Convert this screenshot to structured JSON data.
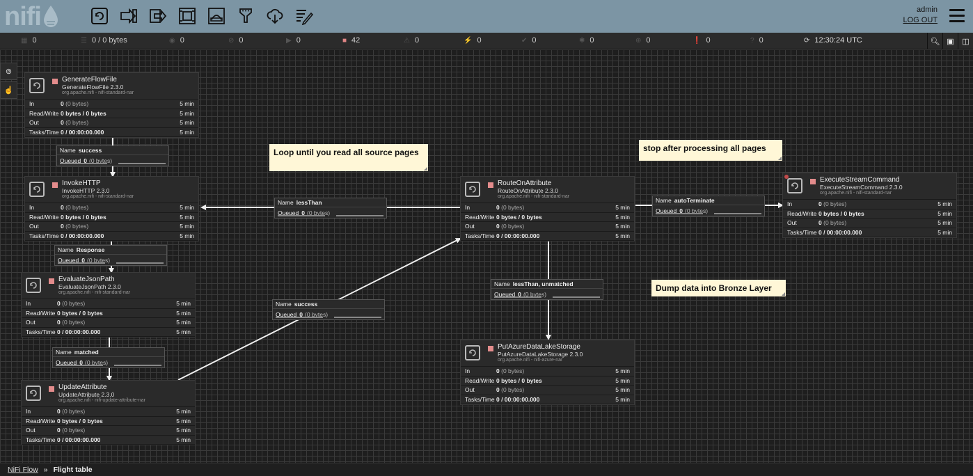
{
  "header": {
    "logo_text": "nifi",
    "user": "admin",
    "logout": "LOG OUT",
    "tools": [
      "processor-icon",
      "input-port-icon",
      "output-port-icon",
      "process-group-icon",
      "remote-process-group-icon",
      "funnel-icon",
      "template-icon",
      "label-icon"
    ]
  },
  "status": {
    "threads": "0",
    "queued": "0 / 0 bytes",
    "transmitting": "0",
    "not_transmitting": "0",
    "running": "0",
    "stopped": "42",
    "invalid": "0",
    "disabled": "0",
    "up_to_date": "0",
    "locally_modified": "0",
    "stale": "0",
    "locally_modified_stale": "0",
    "sync_failure": "0",
    "last_refresh": "12:30:24 UTC"
  },
  "processors": [
    {
      "name": "GenerateFlowFile",
      "type": "GenerateFlowFile 2.3.0",
      "bundle": "org.apache.nifi - nifi-standard-nar",
      "in": "0",
      "in_b": "(0 bytes)",
      "rw": "0 bytes / 0 bytes",
      "out": "0",
      "out_b": "(0 bytes)",
      "tasks": "0 / 00:00:00.000",
      "window": "5 min"
    },
    {
      "name": "InvokeHTTP",
      "type": "InvokeHTTP 2.3.0",
      "bundle": "org.apache.nifi - nifi-standard-nar",
      "in": "0",
      "in_b": "(0 bytes)",
      "rw": "0 bytes / 0 bytes",
      "out": "0",
      "out_b": "(0 bytes)",
      "tasks": "0 / 00:00:00.000",
      "window": "5 min"
    },
    {
      "name": "EvaluateJsonPath",
      "type": "EvaluateJsonPath 2.3.0",
      "bundle": "org.apache.nifi - nifi-standard-nar",
      "in": "0",
      "in_b": "(0 bytes)",
      "rw": "0 bytes / 0 bytes",
      "out": "0",
      "out_b": "(0 bytes)",
      "tasks": "0 / 00:00:00.000",
      "window": "5 min"
    },
    {
      "name": "UpdateAttribute",
      "type": "UpdateAttribute 2.3.0",
      "bundle": "org.apache.nifi - nifi-update-attribute-nar",
      "in": "0",
      "in_b": "(0 bytes)",
      "rw": "0 bytes / 0 bytes",
      "out": "0",
      "out_b": "(0 bytes)",
      "tasks": "0 / 00:00:00.000",
      "window": "5 min"
    },
    {
      "name": "RouteOnAttribute",
      "type": "RouteOnAttribute 2.3.0",
      "bundle": "org.apache.nifi - nifi-standard-nar",
      "in": "0",
      "in_b": "(0 bytes)",
      "rw": "0 bytes / 0 bytes",
      "out": "0",
      "out_b": "(0 bytes)",
      "tasks": "0 / 00:00:00.000",
      "window": "5 min"
    },
    {
      "name": "PutAzureDataLakeStorage",
      "type": "PutAzureDataLakeStorage 2.3.0",
      "bundle": "org.apache.nifi - nifi-azure-nar",
      "in": "0",
      "in_b": "(0 bytes)",
      "rw": "0 bytes / 0 bytes",
      "out": "0",
      "out_b": "(0 bytes)",
      "tasks": "0 / 00:00:00.000",
      "window": "5 min"
    },
    {
      "name": "ExecuteStreamCommand",
      "type": "ExecuteStreamCommand 2.3.0",
      "bundle": "org.apache.nifi - nifi-standard-nar",
      "in": "0",
      "in_b": "(0 bytes)",
      "rw": "0 bytes / 0 bytes",
      "out": "0",
      "out_b": "(0 bytes)",
      "tasks": "0 / 00:00:00.000",
      "window": "5 min"
    }
  ],
  "row_labels": {
    "in": "In",
    "rw": "Read/Write",
    "out": "Out",
    "tasks": "Tasks/Time"
  },
  "connections": [
    {
      "name_label": "Name",
      "name": "success",
      "queued_label": "Queued",
      "queued": "0",
      "queued_b": "(0 bytes)"
    },
    {
      "name_label": "Name",
      "name": "Response",
      "queued_label": "Queued",
      "queued": "0",
      "queued_b": "(0 bytes)"
    },
    {
      "name_label": "Name",
      "name": "matched",
      "queued_label": "Queued",
      "queued": "0",
      "queued_b": "(0 bytes)"
    },
    {
      "name_label": "Name",
      "name": "success",
      "queued_label": "Queued",
      "queued": "0",
      "queued_b": "(0 bytes)"
    },
    {
      "name_label": "Name",
      "name": "lessThan",
      "queued_label": "Queued",
      "queued": "0",
      "queued_b": "(0 bytes)"
    },
    {
      "name_label": "Name",
      "name": "lessThan, unmatched",
      "queued_label": "Queued",
      "queued": "0",
      "queued_b": "(0 bytes)"
    },
    {
      "name_label": "Name",
      "name": "autoTerminate",
      "queued_label": "Queued",
      "queued": "0",
      "queued_b": "(0 bytes)"
    }
  ],
  "labels": [
    "Loop until you read all source pages",
    "stop after processing all pages",
    "Dump data into Bronze Layer"
  ],
  "breadcrumb": {
    "root": "NiFi Flow",
    "sep": "»",
    "current": "Flight table"
  }
}
